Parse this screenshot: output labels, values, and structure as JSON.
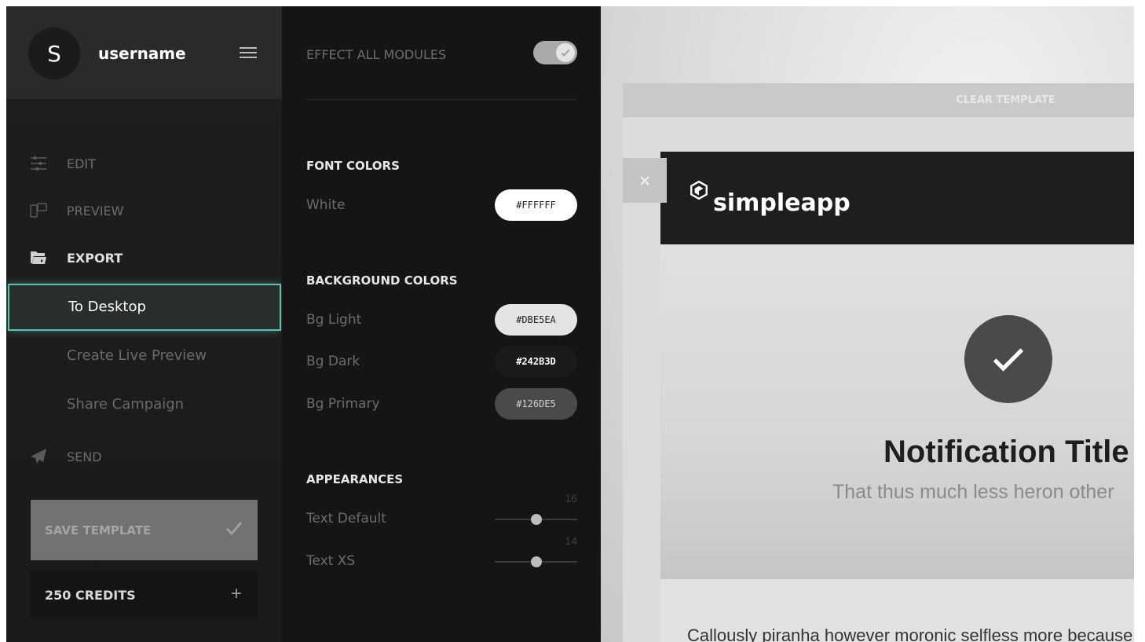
{
  "user": {
    "avatar_letter": "S",
    "username": "username"
  },
  "nav": {
    "edit": "EDIT",
    "preview": "PREVIEW",
    "export": "EXPORT",
    "send": "SEND",
    "export_items": [
      "To Desktop",
      "Create Live Preview",
      "Share Campaign"
    ]
  },
  "actions": {
    "save_template": "SAVE TEMPLATE",
    "credits": "250 CREDITS",
    "credits_plus": "+"
  },
  "panel": {
    "effect_all_modules": "EFFECT ALL MODULES",
    "effect_all_modules_on": true,
    "font_colors_title": "FONT COLORS",
    "font_colors": [
      {
        "label": "White",
        "value": "#FFFFFF"
      }
    ],
    "background_colors_title": "BACKGROUND COLORS",
    "background_colors": [
      {
        "label": "Bg Light",
        "value": "#DBE5EA"
      },
      {
        "label": "Bg Dark",
        "value": "#242B3D"
      },
      {
        "label": "Bg Primary",
        "value": "#126DE5"
      }
    ],
    "appearances_title": "APPEARANCES",
    "appearances": [
      {
        "label": "Text Default",
        "value": "16"
      },
      {
        "label": "Text XS",
        "value": "14"
      }
    ]
  },
  "preview": {
    "clear_template": "CLEAR TEMPLATE",
    "close_symbol": "×",
    "brand": "simpleapp",
    "notification_title": "Notification Title",
    "notification_subtitle": "That thus much less heron other",
    "body_text": "Callously piranha however moronic selfless more because"
  },
  "colors": {
    "accent": "#5fbfae",
    "sidebar_bg": "#1e1e1e",
    "panel_bg": "#151515",
    "header_bg": "#1e1e1e"
  },
  "icons": [
    "sliders-icon",
    "devices-icon",
    "export-folder-icon",
    "paper-plane-icon",
    "hamburger-menu-icon",
    "check-icon",
    "close-icon",
    "cube-logo-icon"
  ]
}
